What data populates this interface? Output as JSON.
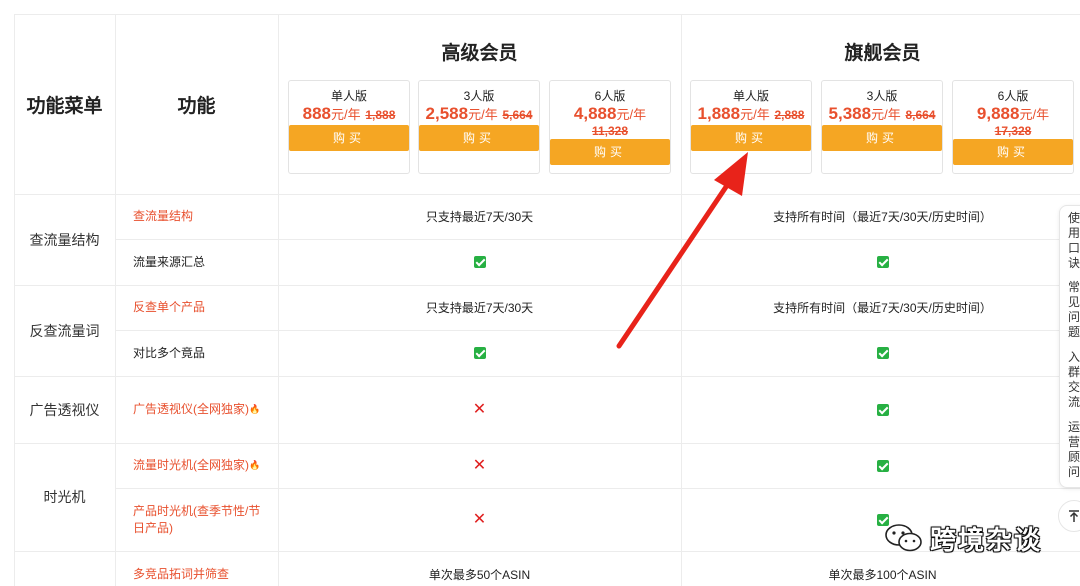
{
  "header": {
    "menu_title": "功能菜单",
    "feature_title": "功能"
  },
  "tiers": [
    {
      "name": "高级会员",
      "plans": [
        {
          "name": "单人版",
          "price": "888",
          "unit": "元/年",
          "old": "1,888",
          "buy": "购买"
        },
        {
          "name": "3人版",
          "price": "2,588",
          "unit": "元/年",
          "old": "5,664",
          "buy": "购买"
        },
        {
          "name": "6人版",
          "price": "4,888",
          "unit": "元/年",
          "old": "11,328",
          "buy": "购买"
        }
      ]
    },
    {
      "name": "旗舰会员",
      "plans": [
        {
          "name": "单人版",
          "price": "1,888",
          "unit": "元/年",
          "old": "2,888",
          "buy": "购买"
        },
        {
          "name": "3人版",
          "price": "5,388",
          "unit": "元/年",
          "old": "8,664",
          "buy": "购买"
        },
        {
          "name": "6人版",
          "price": "9,888",
          "unit": "元/年",
          "old": "17,328",
          "buy": "购买"
        }
      ]
    }
  ],
  "groups": [
    {
      "menu": "查流量结构"
    },
    {
      "menu": "反查流量词"
    },
    {
      "menu": "广告透视仪"
    },
    {
      "menu": "时光机"
    }
  ],
  "rows": [
    {
      "feature": "查流量结构",
      "advanced": "只支持最近7天/30天",
      "flagship": "支持所有时间（最近7天/30天/历史时间）"
    },
    {
      "feature": "流量来源汇总",
      "advanced": "check",
      "flagship": "check"
    },
    {
      "feature": "反查单个产品",
      "advanced": "只支持最近7天/30天",
      "flagship": "支持所有时间（最近7天/30天/历史时间）"
    },
    {
      "feature": "对比多个竟品",
      "advanced": "check",
      "flagship": "check"
    },
    {
      "feature": "广告透视仪(全网独家)",
      "advanced": "cross",
      "flagship": "check"
    },
    {
      "feature": "流量时光机(全网独家)",
      "advanced": "cross",
      "flagship": "check"
    },
    {
      "feature": "产品时光机(查季节性/节日产品)",
      "advanced": "cross",
      "flagship": "check"
    },
    {
      "feature": "多竞品拓词并筛查",
      "advanced": "单次最多50个ASIN",
      "flagship": "单次最多100个ASIN"
    }
  ],
  "side_panel": {
    "items": [
      "使用口诀",
      "常见问题",
      "入群交流",
      "运营顾问"
    ]
  },
  "watermark": {
    "text": "跨境杂谈"
  },
  "colors": {
    "accent_orange": "#f5a623",
    "price_red": "#e8502e",
    "check_green": "#27b043",
    "cross_red": "#e02020",
    "arrow_red": "#e8231a"
  }
}
